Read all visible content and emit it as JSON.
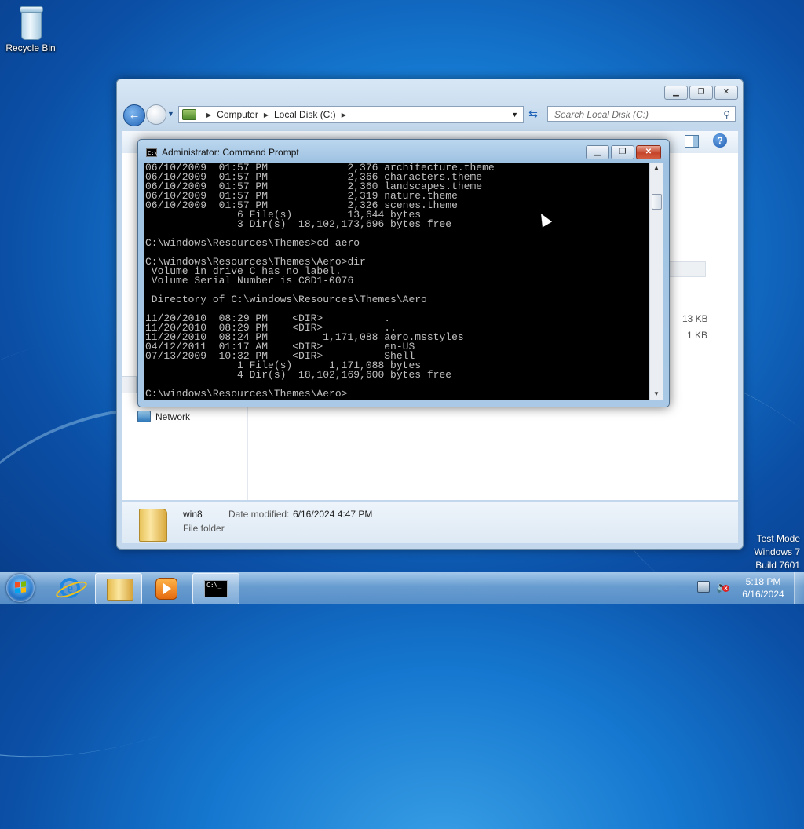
{
  "desktop": {
    "recycle_bin_label": "Recycle Bin",
    "watermark": [
      "Test Mode",
      "Windows 7",
      "Build 7601"
    ]
  },
  "explorer": {
    "breadcrumb": [
      "Computer",
      "Local Disk (C:)"
    ],
    "search_placeholder": "Search Local Disk (C:)",
    "nav_items": {
      "network": "Network"
    },
    "file_sizes": [
      "13 KB",
      "1 KB"
    ],
    "details": {
      "name": "win8",
      "type": "File folder",
      "modified_label": "Date modified:",
      "modified_value": "6/16/2024 4:47 PM"
    }
  },
  "cmd": {
    "title": "Administrator: Command Prompt",
    "icon_text": "C:\\",
    "output": [
      "06/10/2009  01:57 PM             2,376 architecture.theme",
      "06/10/2009  01:57 PM             2,366 characters.theme",
      "06/10/2009  01:57 PM             2,360 landscapes.theme",
      "06/10/2009  01:57 PM             2,319 nature.theme",
      "06/10/2009  01:57 PM             2,326 scenes.theme",
      "               6 File(s)         13,644 bytes",
      "               3 Dir(s)  18,102,173,696 bytes free",
      "",
      "C:\\windows\\Resources\\Themes>cd aero",
      "",
      "C:\\windows\\Resources\\Themes\\Aero>dir",
      " Volume in drive C has no label.",
      " Volume Serial Number is C8D1-0076",
      "",
      " Directory of C:\\windows\\Resources\\Themes\\Aero",
      "",
      "11/20/2010  08:29 PM    <DIR>          .",
      "11/20/2010  08:29 PM    <DIR>          ..",
      "11/20/2010  08:24 PM         1,171,088 aero.msstyles",
      "04/12/2011  01:17 AM    <DIR>          en-US",
      "07/13/2009  10:32 PM    <DIR>          Shell",
      "               1 File(s)      1,171,088 bytes",
      "               4 Dir(s)  18,102,169,600 bytes free",
      "",
      "C:\\windows\\Resources\\Themes\\Aero>"
    ]
  },
  "taskbar": {
    "cmd_icon_text": "C:\\_",
    "clock": {
      "time": "5:18 PM",
      "date": "6/16/2024"
    }
  },
  "colors": {
    "console_bg": "#000000",
    "console_fg": "#c0c0c0",
    "close_button": "#c5442a",
    "flag": [
      "#f25022",
      "#7fba00",
      "#00a4ef",
      "#ffb900"
    ]
  }
}
